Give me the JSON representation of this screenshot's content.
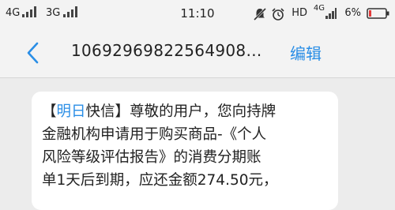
{
  "status_bar": {
    "network_1": "4G",
    "network_2": "3G",
    "time": "11:10",
    "hd_label": "HD",
    "network_3": "4G",
    "battery_percent": "6%"
  },
  "header": {
    "sender_number": "10692969822564908…",
    "edit_label": "编辑"
  },
  "message": {
    "bracket_open": "【",
    "brand_link": "明日",
    "brand_rest": "快信",
    "bracket_close": "】",
    "line1_rest": "尊敬的用户，您向持牌",
    "line2": "金融机构申请用于购买商品-《个人",
    "line3": "风险等级评估报告》的消费分期账",
    "line4": "单1天后到期，应还金额274.50元，"
  },
  "icons": {
    "back": "chevron-left-icon",
    "mute": "bell-slash-icon",
    "alarm": "alarm-clock-icon",
    "battery": "battery-icon"
  },
  "colors": {
    "accent": "#2a8ee6",
    "background": "#ececec",
    "bubble": "#ffffff"
  }
}
